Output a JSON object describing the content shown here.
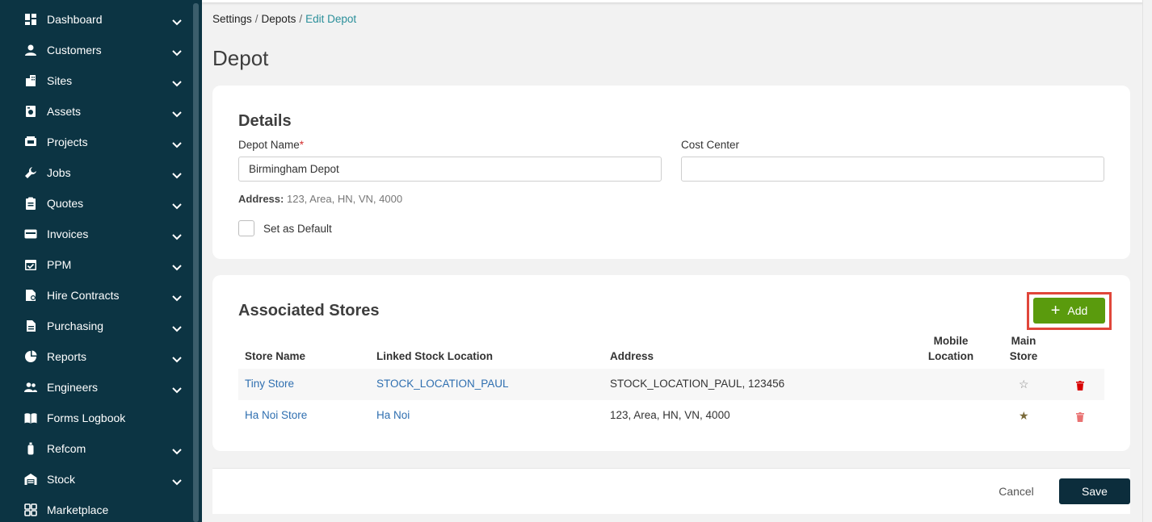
{
  "sidebar": {
    "items": [
      {
        "label": "Dashboard",
        "icon": "dashboard-icon",
        "chevron": true
      },
      {
        "label": "Customers",
        "icon": "person-icon",
        "chevron": true
      },
      {
        "label": "Sites",
        "icon": "building-icon",
        "chevron": true
      },
      {
        "label": "Assets",
        "icon": "asset-icon",
        "chevron": true
      },
      {
        "label": "Projects",
        "icon": "projects-icon",
        "chevron": true
      },
      {
        "label": "Jobs",
        "icon": "wrench-icon",
        "chevron": true
      },
      {
        "label": "Quotes",
        "icon": "clipboard-icon",
        "chevron": true
      },
      {
        "label": "Invoices",
        "icon": "card-icon",
        "chevron": true
      },
      {
        "label": "PPM",
        "icon": "calendar-check-icon",
        "chevron": true
      },
      {
        "label": "Hire Contracts",
        "icon": "contract-icon",
        "chevron": true
      },
      {
        "label": "Purchasing",
        "icon": "document-icon",
        "chevron": true
      },
      {
        "label": "Reports",
        "icon": "pie-chart-icon",
        "chevron": true
      },
      {
        "label": "Engineers",
        "icon": "people-icon",
        "chevron": true
      },
      {
        "label": "Forms Logbook",
        "icon": "book-icon",
        "chevron": false
      },
      {
        "label": "Refcom",
        "icon": "cylinder-icon",
        "chevron": true
      },
      {
        "label": "Stock",
        "icon": "warehouse-icon",
        "chevron": true
      },
      {
        "label": "Marketplace",
        "icon": "grid-icon",
        "chevron": false
      }
    ]
  },
  "breadcrumb": {
    "items": [
      "Settings",
      "Depots"
    ],
    "current": "Edit Depot",
    "separator": "/"
  },
  "page": {
    "title": "Depot"
  },
  "details": {
    "title": "Details",
    "depot_name_label": "Depot Name",
    "required_mark": "*",
    "depot_name_value": "Birmingham Depot",
    "cost_center_label": "Cost Center",
    "cost_center_value": "",
    "address_label": "Address:",
    "address_value": "123, Area, HN, VN, 4000",
    "default_label": "Set as Default",
    "default_checked": false
  },
  "stores": {
    "title": "Associated Stores",
    "add_label": "Add",
    "columns": {
      "store_name": "Store Name",
      "linked_stock_location": "Linked Stock Location",
      "address": "Address",
      "mobile_location_1": "Mobile",
      "mobile_location_2": "Location",
      "main_store_1": "Main",
      "main_store_2": "Store"
    },
    "rows": [
      {
        "store_name": "Tiny Store",
        "linked_stock_location": "STOCK_LOCATION_PAUL",
        "address": "STOCK_LOCATION_PAUL, 123456",
        "mobile_location": "",
        "main_store": false
      },
      {
        "store_name": "Ha Noi Store",
        "linked_stock_location": "Ha Noi",
        "address": "123, Area, HN, VN, 4000",
        "mobile_location": "",
        "main_store": true
      }
    ]
  },
  "footer": {
    "cancel_label": "Cancel",
    "save_label": "Save"
  },
  "colors": {
    "sidebar_bg": "#0c3443",
    "accent_green": "#5a9b0d",
    "highlight_red": "#e0463a",
    "link_blue": "#2f6fb0",
    "breadcrumb_current": "#2a8f9a",
    "save_bg": "#0c2d3c"
  }
}
